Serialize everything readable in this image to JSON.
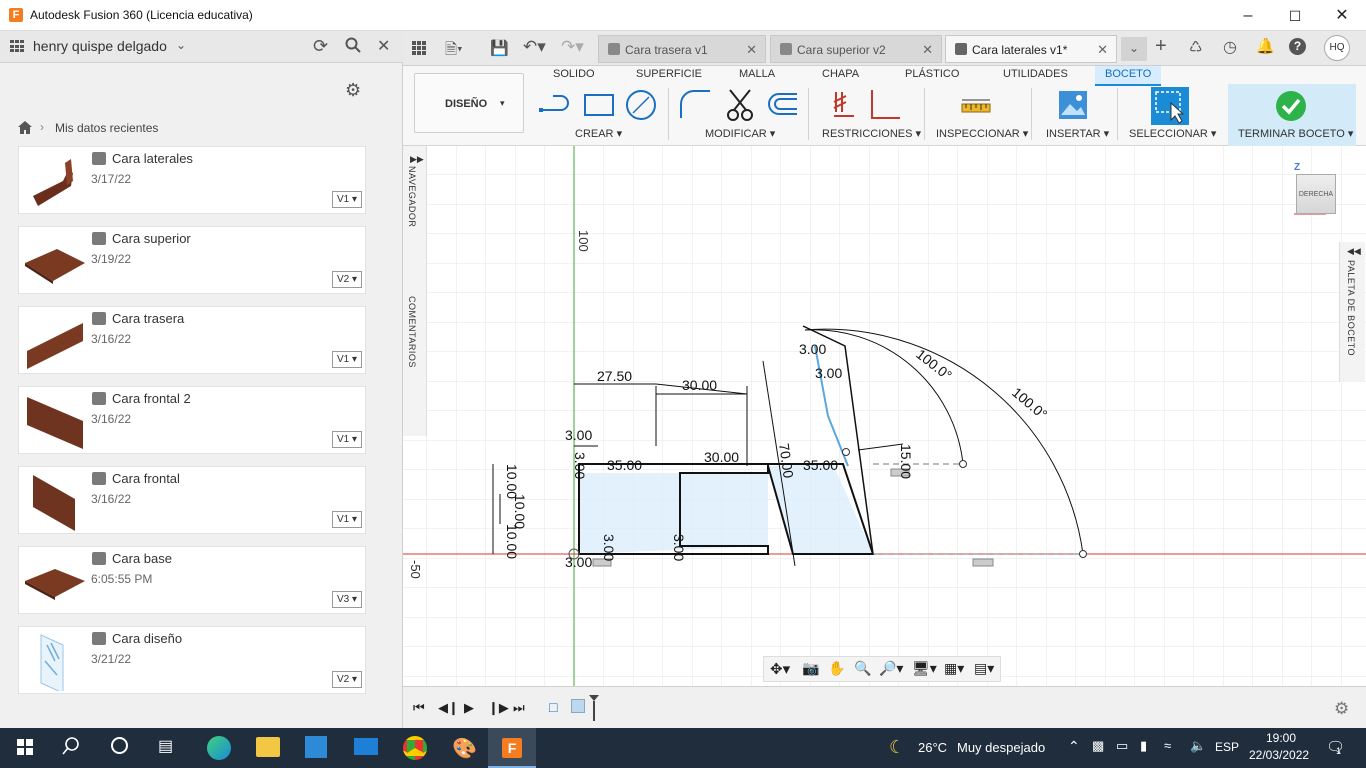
{
  "window": {
    "title": "Autodesk Fusion 360 (Licencia educativa)"
  },
  "datapanel": {
    "user": "henry quispe delgado",
    "breadcrumb": "Mis datos recientes",
    "items": [
      {
        "name": "Cara laterales",
        "date": "3/17/22",
        "version": "V1"
      },
      {
        "name": "Cara superior",
        "date": "3/19/22",
        "version": "V2"
      },
      {
        "name": "Cara trasera",
        "date": "3/16/22",
        "version": "V1"
      },
      {
        "name": "Cara frontal 2",
        "date": "3/16/22",
        "version": "V1"
      },
      {
        "name": "Cara frontal",
        "date": "3/16/22",
        "version": "V1"
      },
      {
        "name": "Cara base",
        "date": "6:05:55 PM",
        "version": "V3"
      },
      {
        "name": "Cara diseño",
        "date": "3/21/22",
        "version": "V2"
      }
    ]
  },
  "tabs": [
    {
      "label": "Cara trasera v1"
    },
    {
      "label": "Cara superior v2"
    },
    {
      "label": "Cara laterales v1*"
    }
  ],
  "user_initials": "HQ",
  "ribbon": {
    "workspace": "DISEÑO",
    "tabs": [
      "SOLIDO",
      "SUPERFICIE",
      "MALLA",
      "CHAPA",
      "PLÁSTICO",
      "UTILIDADES",
      "BOCETO"
    ],
    "groups": [
      "CREAR",
      "MODIFICAR",
      "RESTRICCIONES",
      "INSPECCIONAR",
      "INSERTAR",
      "SELECCIONAR",
      "TERMINAR BOCETO"
    ]
  },
  "side": {
    "navegador": "NAVEGADOR",
    "comentarios": "COMENTARIOS",
    "paleta": "PALETA DE BOCETO"
  },
  "viewcube": {
    "face": "DERECHA",
    "axis": "Z"
  },
  "sketch": {
    "axis_labels": [
      "100",
      "-50"
    ],
    "dims": [
      "27.50",
      "30.00",
      "3.00",
      "35.00",
      "30.00",
      "35.00",
      "70.00",
      "15.00",
      "10.00",
      "10.00",
      "10.00",
      "3.00",
      "3.00",
      "3.00",
      "3.00",
      "3.00",
      "3.00",
      "100.0°",
      "100.0°"
    ]
  },
  "taskbar": {
    "temp": "26°C",
    "weather": "Muy despejado",
    "lang": "ESP",
    "time": "19:00",
    "date": "22/03/2022",
    "notif": "1"
  }
}
